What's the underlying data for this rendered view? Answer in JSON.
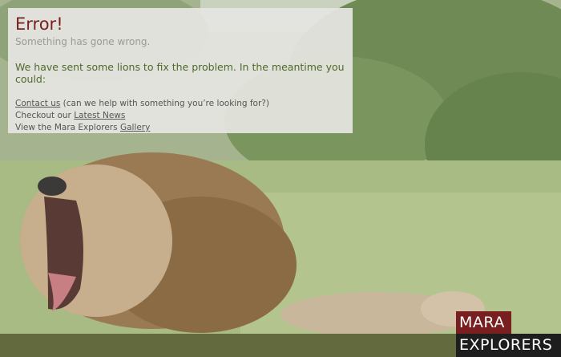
{
  "error": {
    "title": "Error!",
    "subtitle": "Something has gone wrong.",
    "lead": "We have sent some lions to fix the problem. In the meantime you could:"
  },
  "links": {
    "contact_label": "Contact us",
    "contact_suffix": " (can we help with something you’re looking for?)",
    "news_prefix": "Checkout our ",
    "news_label": "Latest News",
    "gallery_prefix": "View the Mara Explorers ",
    "gallery_label": "Gallery"
  },
  "logo": {
    "line1": "MARA",
    "line2": "EXPLORERS"
  },
  "colors": {
    "title": "#7a1f1f",
    "lead": "#4d6a2b",
    "footer": "#626a3e",
    "logo_red": "#7a1f1f",
    "logo_dark": "#1e1e1e"
  }
}
